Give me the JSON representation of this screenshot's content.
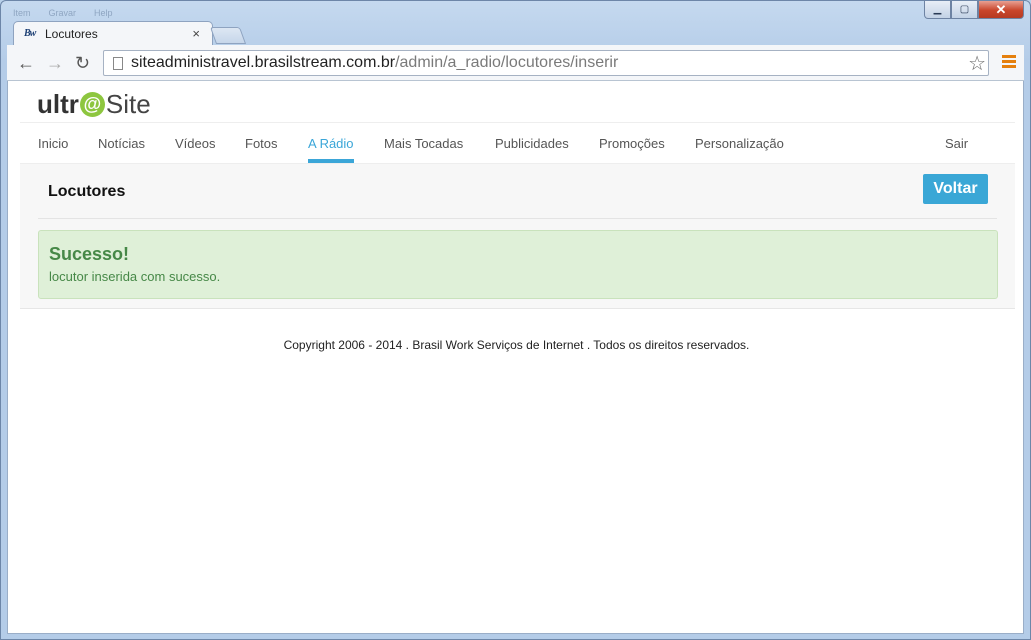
{
  "window": {
    "menu_ghost": [
      "Item",
      "Gravar",
      "Help"
    ],
    "controls": {
      "minimize": "▁",
      "maximize": "▢",
      "close": "✕"
    }
  },
  "tab": {
    "favicon_text": "Bw",
    "title": "Locutores",
    "close": "×"
  },
  "toolbar": {
    "back_icon": "←",
    "forward_icon": "→",
    "reload_icon": "↻",
    "url_host": "siteadministravel.brasilstream.com.br",
    "url_path": "/admin/a_radio/locutores/inserir",
    "star_icon": "☆"
  },
  "logo": {
    "part1": "ultr",
    "at": "@",
    "part2": "Site"
  },
  "nav": {
    "items": [
      {
        "label": "Inicio"
      },
      {
        "label": "Notícias"
      },
      {
        "label": "Vídeos"
      },
      {
        "label": "Fotos"
      },
      {
        "label": "A Rádio"
      },
      {
        "label": "Mais Tocadas"
      },
      {
        "label": "Publicidades"
      },
      {
        "label": "Promoções"
      },
      {
        "label": "Personalização"
      }
    ],
    "active_index": 4,
    "logout_label": "Sair"
  },
  "panel": {
    "title": "Locutores",
    "back_button": "Voltar"
  },
  "alert": {
    "title": "Sucesso!",
    "message": "locutor inserida com sucesso."
  },
  "footer": {
    "text": "Copyright 2006 - 2014 . Brasil Work Serviços de Internet . Todos os direitos reservados."
  },
  "colors": {
    "accent": "#3aa7d6",
    "success_bg": "#dff0d8",
    "success_text": "#468847",
    "logo_green": "#8dc63f"
  }
}
